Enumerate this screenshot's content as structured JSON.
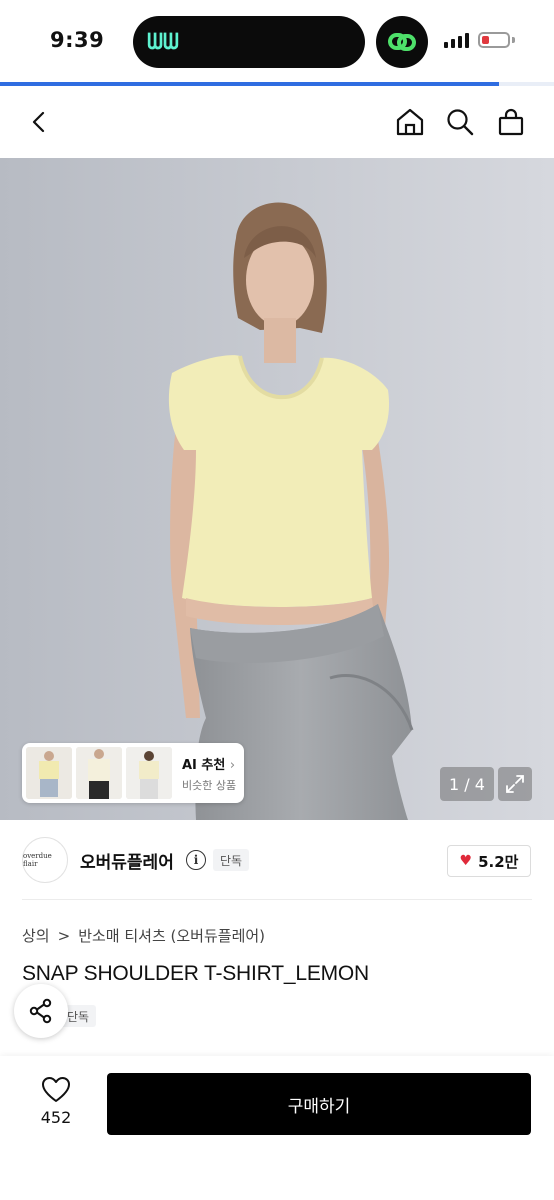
{
  "status_bar": {
    "time": "9:39",
    "island_app_glyph": "ᗯᗯ",
    "battery_color": "#e0393e",
    "load_progress": 0.9
  },
  "nav": {
    "back_icon": "chevron-left-icon",
    "home_icon": "home-icon",
    "search_icon": "search-icon",
    "bag_icon": "shopping-bag-icon"
  },
  "hero": {
    "ai_recommend": {
      "title": "AI 추천",
      "subtitle": "비슷한 상품",
      "chevron": "›"
    },
    "image_counter": "1 / 4",
    "expand_icon": "expand-icon"
  },
  "brand": {
    "logo_text": "overdue flair",
    "name": "오버듀플레어",
    "exclusive_tag": "단독",
    "likes": "5.2만"
  },
  "product": {
    "breadcrumb": [
      "상의",
      "반소매 티셔츠 (오버듀플레어)"
    ],
    "breadcrumb_sep": ">",
    "title": "SNAP SHOULDER T-SHIRT_LEMON",
    "exclusive_tag": "단독"
  },
  "bottom_bar": {
    "favorite_count": "452",
    "buy_label": "구매하기",
    "buy_color": "#000000"
  }
}
